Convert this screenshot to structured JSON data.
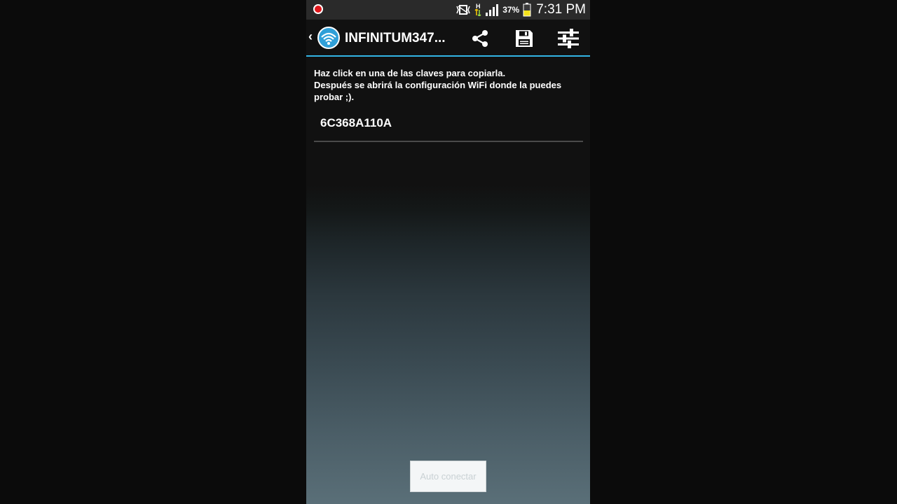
{
  "status_bar": {
    "battery_percent": "37%",
    "time": "7:31 PM",
    "network_type": "H",
    "icons": [
      "record-icon",
      "vibrate-icon",
      "data-arrows-icon",
      "signal-icon",
      "battery-icon"
    ]
  },
  "action_bar": {
    "back_glyph": "‹",
    "title": "INFINITUM347...",
    "icons": [
      "wifi-app-icon",
      "share-icon",
      "save-icon",
      "sliders-icon"
    ],
    "accent_color": "#33b5e5"
  },
  "content": {
    "instructions": [
      "Haz click en una de las claves para copiarla.",
      "Después se abrirá la configuración WiFi donde la puedes probar ;)."
    ],
    "keys": [
      "6C368A110A"
    ]
  },
  "auto_connect_label": "Auto conectar"
}
